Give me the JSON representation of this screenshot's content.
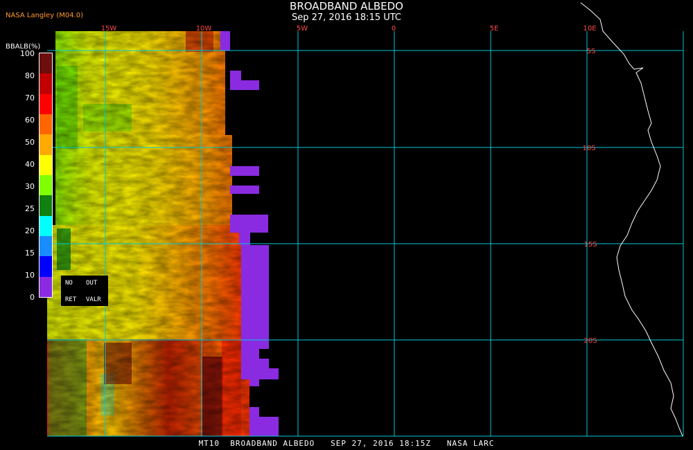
{
  "header": {
    "title": "BROADBAND ALBEDO",
    "timestamp": "Sep 27, 2016 18:15 UTC",
    "provider": "NASA Langley (M04.0)"
  },
  "footer": {
    "caption": "MT10  BROADBAND ALBEDO   SEP 27, 2016 18:15Z   NASA LARC"
  },
  "map": {
    "lon_labels": [
      "15W",
      "10W",
      "5W",
      "0",
      "5E",
      "10E"
    ],
    "lat_labels": [
      "5S",
      "10S",
      "15S",
      "20S"
    ],
    "grid_color": "#00c8d8",
    "label_color": "#ff3030"
  },
  "colorbar": {
    "unit_label": "BBALB(%)",
    "ticks": [
      "100",
      "80",
      "70",
      "60",
      "50",
      "40",
      "30",
      "25",
      "20",
      "15",
      "10",
      "0"
    ],
    "colors": [
      "#6a0e0e",
      "#c00000",
      "#ff0000",
      "#ff6600",
      "#ffaa00",
      "#ffff00",
      "#80ff00",
      "#108010",
      "#00ffff",
      "#1a8cff",
      "#0000ff",
      "#8a2be2"
    ],
    "nodata_box": {
      "no": "NO",
      "out": "OUT",
      "ret": "RET",
      "valr": "VALR"
    }
  }
}
